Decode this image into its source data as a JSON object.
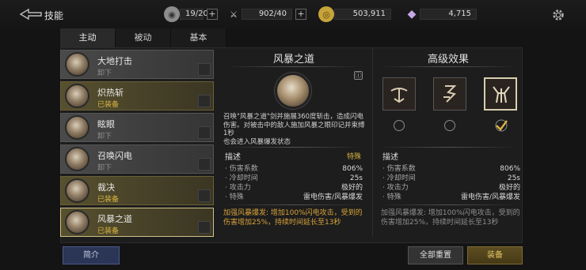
{
  "header": {
    "title": "技能",
    "resources": [
      {
        "name": "silver-coin-icon",
        "value": "19/20",
        "has_plus": true
      },
      {
        "name": "sword-icon",
        "value": "902/40",
        "has_plus": true
      },
      {
        "name": "gold-coin-icon",
        "value": "503,911",
        "has_plus": false
      },
      {
        "name": "gem-icon",
        "value": "4,715",
        "has_plus": false
      }
    ]
  },
  "tabs": [
    {
      "label": "主动",
      "active": true
    },
    {
      "label": "被动",
      "active": false
    },
    {
      "label": "基本",
      "active": false
    }
  ],
  "skills": [
    {
      "name": "大地打击",
      "status": "卸下",
      "equipped": false
    },
    {
      "name": "炽热斩",
      "status": "已装备",
      "equipped": true
    },
    {
      "name": "眩眼",
      "status": "卸下",
      "equipped": false
    },
    {
      "name": "召唤闪电",
      "status": "卸下",
      "equipped": false
    },
    {
      "name": "裁决",
      "status": "已装备",
      "equipped": true
    },
    {
      "name": "风暴之道",
      "status": "已装备",
      "equipped": true,
      "selected": true
    }
  ],
  "detail": {
    "title": "风暴之道",
    "info_label": "ⓘ",
    "description": "召唤\"风暴之道\"剑并施展360度斩击，造成闪电伤害。对被击中的敌人施加风暴之眼印记并束缚1秒\n也会进入风暴爆发状态",
    "section_label": "描述",
    "section_tag": "特殊",
    "stats": [
      {
        "label": "· 伤害系数",
        "value": "806%"
      },
      {
        "label": "· 冷却时间",
        "value": "25s"
      },
      {
        "label": "· 攻击力",
        "value": "极好的"
      },
      {
        "label": "· 特殊",
        "value": "雷电伤害/风暴爆发"
      }
    ],
    "bonus": "加强风暴爆发: 增加100%闪电攻击，受到的伤害增加25%，持续时间延长至13秒"
  },
  "advanced": {
    "title": "高级效果",
    "effects": [
      {
        "icon": "crossbow-rune-icon",
        "selected": false
      },
      {
        "icon": "serpent-rune-icon",
        "selected": false
      },
      {
        "icon": "claw-rune-icon",
        "selected": true
      }
    ],
    "section_label": "描述",
    "stats": [
      {
        "label": "· 伤害系数",
        "value": "806%"
      },
      {
        "label": "· 冷却时间",
        "value": "25s"
      },
      {
        "label": "· 攻击力",
        "value": "极好的"
      },
      {
        "label": "· 特殊",
        "value": "雷电伤害/风暴爆发"
      }
    ],
    "bonus": "加强风暴爆发: 增加100%闪电攻击，受到的伤害增加25%，持续时间延长至13秒"
  },
  "buttons": {
    "intro": "简介",
    "reset_all": "全部重置",
    "equip": "装备"
  },
  "colors": {
    "accent_gold": "#d8b441",
    "equipped_bg": "#57502f",
    "intro_blue": "#2b3555"
  }
}
